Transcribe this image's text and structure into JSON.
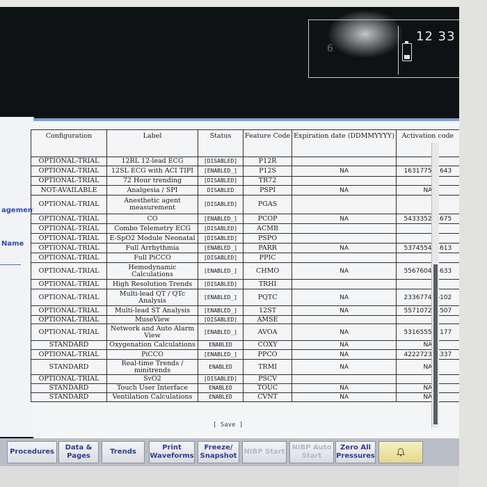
{
  "status": {
    "time": "12 33",
    "faint_value": "6"
  },
  "left_panel": {
    "labels": [
      "agement",
      "Name"
    ]
  },
  "table": {
    "headers": [
      "Configuration",
      "Label",
      "Status",
      "Feature Code",
      "Expiration date (DDMMYYYY)",
      "Activation code"
    ],
    "rows": [
      {
        "config": "OPTIONAL-TRIAL",
        "label": "12RL 12-lead ECG",
        "status": "[DISABLED]",
        "code": "P12R",
        "exp": "",
        "act": ""
      },
      {
        "config": "OPTIONAL-TRIAL",
        "label": "12SL ECG with ACI TIPI",
        "status": "[ENABLED_]",
        "code": "P12S",
        "exp": "NA",
        "act": "163177571643"
      },
      {
        "config": "OPTIONAL-TRIAL",
        "label": "72 Hour trending",
        "status": "[DISABLED]",
        "code": "TR72",
        "exp": "",
        "act": ""
      },
      {
        "config": "NOT-AVAILABLE",
        "label": "Analgesia / SPI",
        "status": "DISABLED",
        "code": "PSPI",
        "exp": "NA",
        "act": "NA"
      },
      {
        "config": "OPTIONAL-TRIAL",
        "label": "Anesthetic agent measurement",
        "status": "[DISABLED]",
        "code": "PGAS",
        "exp": "",
        "act": ""
      },
      {
        "config": "OPTIONAL-TRIAL",
        "label": "CO",
        "status": "[ENABLED_]",
        "code": "PCOP",
        "exp": "NA",
        "act": "543335255675"
      },
      {
        "config": "OPTIONAL-TRIAL",
        "label": "Combo Telemetry ECG",
        "status": "[DISABLED]",
        "code": "ACMB",
        "exp": "",
        "act": ""
      },
      {
        "config": "OPTIONAL-TRIAL",
        "label": "E-SpO2 Module Neonatal",
        "status": "[DISABLED]",
        "code": "PSPO",
        "exp": "",
        "act": ""
      },
      {
        "config": "OPTIONAL-TRIAL",
        "label": "Full Arrhythmia",
        "status": "[ENABLED_]",
        "code": "PARR",
        "exp": "NA",
        "act": "537455424613"
      },
      {
        "config": "OPTIONAL-TRIAL",
        "label": "Full PiCCO",
        "status": "[DISABLED]",
        "code": "PPIC",
        "exp": "",
        "act": ""
      },
      {
        "config": "OPTIONAL-TRIAL",
        "label": "Hemodynamic Calculations",
        "status": "[ENABLED_]",
        "code": "CHMO",
        "exp": "NA",
        "act": "556760475633"
      },
      {
        "config": "OPTIONAL-TRIAL",
        "label": "High Resolution Trends",
        "status": "[DISABLED]",
        "code": "TRHI",
        "exp": "",
        "act": ""
      },
      {
        "config": "OPTIONAL-TRIAL",
        "label": "Multi-lead QT / QTc Analysis",
        "status": "[ENABLED_]",
        "code": "PQTC",
        "exp": "NA",
        "act": "233677466102"
      },
      {
        "config": "OPTIONAL-TRIAL",
        "label": "Multi-lead ST Analysis",
        "status": "[ENABLED_]",
        "code": "12ST",
        "exp": "NA",
        "act": "557107235507"
      },
      {
        "config": "OPTIONAL-TRIAL",
        "label": "MuseView",
        "status": "[DISABLED]",
        "code": "AMSE",
        "exp": "",
        "act": ""
      },
      {
        "config": "OPTIONAL-TRIAL",
        "label": "Network and Auto Alarm View",
        "status": "[ENABLED_]",
        "code": "AVOA",
        "exp": "NA",
        "act": "531655577177"
      },
      {
        "config": "STANDARD",
        "label": "Oxygenation Calculations",
        "status": "ENABLED",
        "code": "COXY",
        "exp": "NA",
        "act": "NA"
      },
      {
        "config": "OPTIONAL-TRIAL",
        "label": "PiCCO",
        "status": "[ENABLED_]",
        "code": "PPCO",
        "exp": "NA",
        "act": "422272324337"
      },
      {
        "config": "STANDARD",
        "label": "Real-time Trends / minitrends",
        "status": "ENABLED",
        "code": "TRMI",
        "exp": "NA",
        "act": "NA"
      },
      {
        "config": "OPTIONAL-TRIAL",
        "label": "SvO2",
        "status": "[DISABLED]",
        "code": "PSCV",
        "exp": "",
        "act": ""
      },
      {
        "config": "STANDARD",
        "label": "Touch User Interface",
        "status": "ENABLED",
        "code": "TOUC",
        "exp": "NA",
        "act": "NA"
      },
      {
        "config": "STANDARD",
        "label": "Ventilation Calculations",
        "status": "ENABLED",
        "code": "CVNT",
        "exp": "NA",
        "act": "NA"
      }
    ],
    "save_label": "[ Save ]"
  },
  "bottom_bar": {
    "buttons": [
      {
        "label": "Procedures",
        "enabled": true
      },
      {
        "label": "Data & Pages",
        "enabled": true
      },
      {
        "label": "Trends",
        "enabled": true
      },
      {
        "label": "Print Waveforms",
        "enabled": true
      },
      {
        "label": "Freeze/ Snapshot",
        "enabled": true
      },
      {
        "label": "NIBP Start",
        "enabled": false
      },
      {
        "label": "NIBP Auto Start",
        "enabled": false
      },
      {
        "label": "Zero All Pressures",
        "enabled": true
      }
    ],
    "alarm_icon": "bell-icon"
  },
  "colors": {
    "accent_blue": "#2c4fb0",
    "alarm_yellow": "#e4d98e",
    "screen_dark": "#111417"
  }
}
